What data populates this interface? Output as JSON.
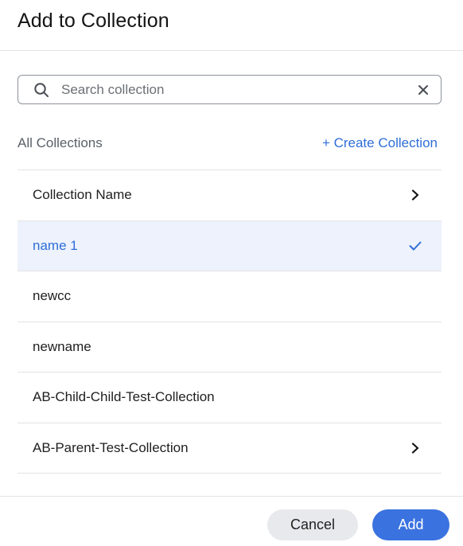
{
  "dialog": {
    "title": "Add to Collection"
  },
  "search": {
    "placeholder": "Search collection",
    "value": ""
  },
  "section": {
    "label": "All Collections",
    "create_label": "+ Create Collection"
  },
  "collections": [
    {
      "name": "Collection Name",
      "selected": false,
      "trail": "chevron-right-icon"
    },
    {
      "name": "name 1",
      "selected": true,
      "trail": "check-icon"
    },
    {
      "name": "newcc",
      "selected": false,
      "trail": ""
    },
    {
      "name": "newname",
      "selected": false,
      "trail": ""
    },
    {
      "name": "AB-Child-Child-Test-Collection",
      "selected": false,
      "trail": ""
    },
    {
      "name": "AB-Parent-Test-Collection",
      "selected": false,
      "trail": "chevron-right-icon"
    },
    {
      "name": "",
      "selected": false,
      "trail": ""
    }
  ],
  "footer": {
    "cancel_label": "Cancel",
    "add_label": "Add"
  },
  "colors": {
    "accent": "#2f6ed8",
    "selected_bg": "#edf2fc",
    "primary_button": "#3a72e0"
  }
}
